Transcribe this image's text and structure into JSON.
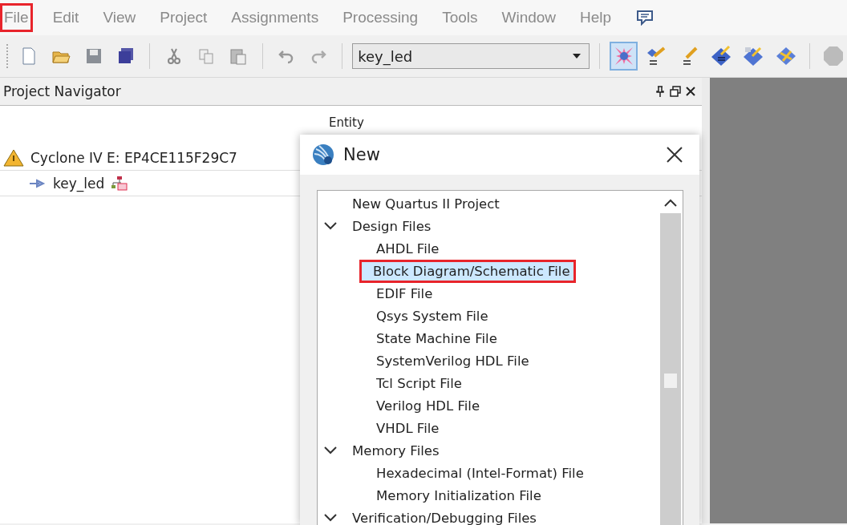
{
  "menu_bar": {
    "items": [
      {
        "label": "File",
        "annotated": true
      },
      {
        "label": "Edit",
        "annotated": false
      },
      {
        "label": "View",
        "annotated": false
      },
      {
        "label": "Project",
        "annotated": false
      },
      {
        "label": "Assignments",
        "annotated": false
      },
      {
        "label": "Processing",
        "annotated": false
      },
      {
        "label": "Tools",
        "annotated": false
      },
      {
        "label": "Window",
        "annotated": false
      },
      {
        "label": "Help",
        "annotated": false
      }
    ]
  },
  "toolbar": {
    "groups_left": [
      [
        {
          "kind": "new",
          "pressed": false
        },
        {
          "kind": "open",
          "pressed": false
        },
        {
          "kind": "save",
          "pressed": false
        },
        {
          "kind": "save-all",
          "pressed": false
        }
      ],
      [
        {
          "kind": "cut",
          "pressed": false
        },
        {
          "kind": "copy",
          "pressed": false
        },
        {
          "kind": "paste",
          "pressed": false
        }
      ],
      [
        {
          "kind": "undo",
          "pressed": false
        },
        {
          "kind": "redo",
          "pressed": false
        }
      ]
    ],
    "entity_selector": {
      "value": "key_led"
    },
    "groups_right": [
      [
        {
          "kind": "star",
          "pressed": true
        },
        {
          "kind": "wand",
          "pressed": false
        },
        {
          "kind": "pencil",
          "pressed": false
        },
        {
          "kind": "diamond",
          "pressed": false
        },
        {
          "kind": "diamond-pencil",
          "pressed": false
        },
        {
          "kind": "diamond-cross",
          "pressed": false
        }
      ],
      [
        {
          "kind": "stop",
          "pressed": false
        }
      ]
    ]
  },
  "project_navigator": {
    "title": "Project Navigator",
    "column_header": "Entity",
    "tree": [
      {
        "label": "Cyclone IV E: EP4CE115F29C7",
        "kind": "device",
        "children": [
          {
            "label": "key_led",
            "kind": "entity"
          }
        ]
      }
    ]
  },
  "dialog": {
    "title": "New",
    "items": [
      {
        "label": "New Quartus II Project",
        "selected": false,
        "annotated": false
      },
      {
        "label": "Design Files",
        "selected": false,
        "annotated": false,
        "expanded": true,
        "children": [
          {
            "label": "AHDL File",
            "selected": false,
            "annotated": false
          },
          {
            "label": "Block Diagram/Schematic File",
            "selected": true,
            "annotated": true
          },
          {
            "label": "EDIF File",
            "selected": false,
            "annotated": false
          },
          {
            "label": "Qsys System File",
            "selected": false,
            "annotated": false
          },
          {
            "label": "State Machine File",
            "selected": false,
            "annotated": false
          },
          {
            "label": "SystemVerilog HDL File",
            "selected": false,
            "annotated": false
          },
          {
            "label": "Tcl Script File",
            "selected": false,
            "annotated": false
          },
          {
            "label": "Verilog HDL File",
            "selected": false,
            "annotated": false
          },
          {
            "label": "VHDL File",
            "selected": false,
            "annotated": false
          }
        ]
      },
      {
        "label": "Memory Files",
        "selected": false,
        "annotated": false,
        "expanded": true,
        "children": [
          {
            "label": "Hexadecimal (Intel-Format) File",
            "selected": false,
            "annotated": false
          },
          {
            "label": "Memory Initialization File",
            "selected": false,
            "annotated": false
          }
        ]
      },
      {
        "label": "Verification/Debugging Files",
        "selected": false,
        "annotated": false,
        "expanded": true
      }
    ]
  }
}
